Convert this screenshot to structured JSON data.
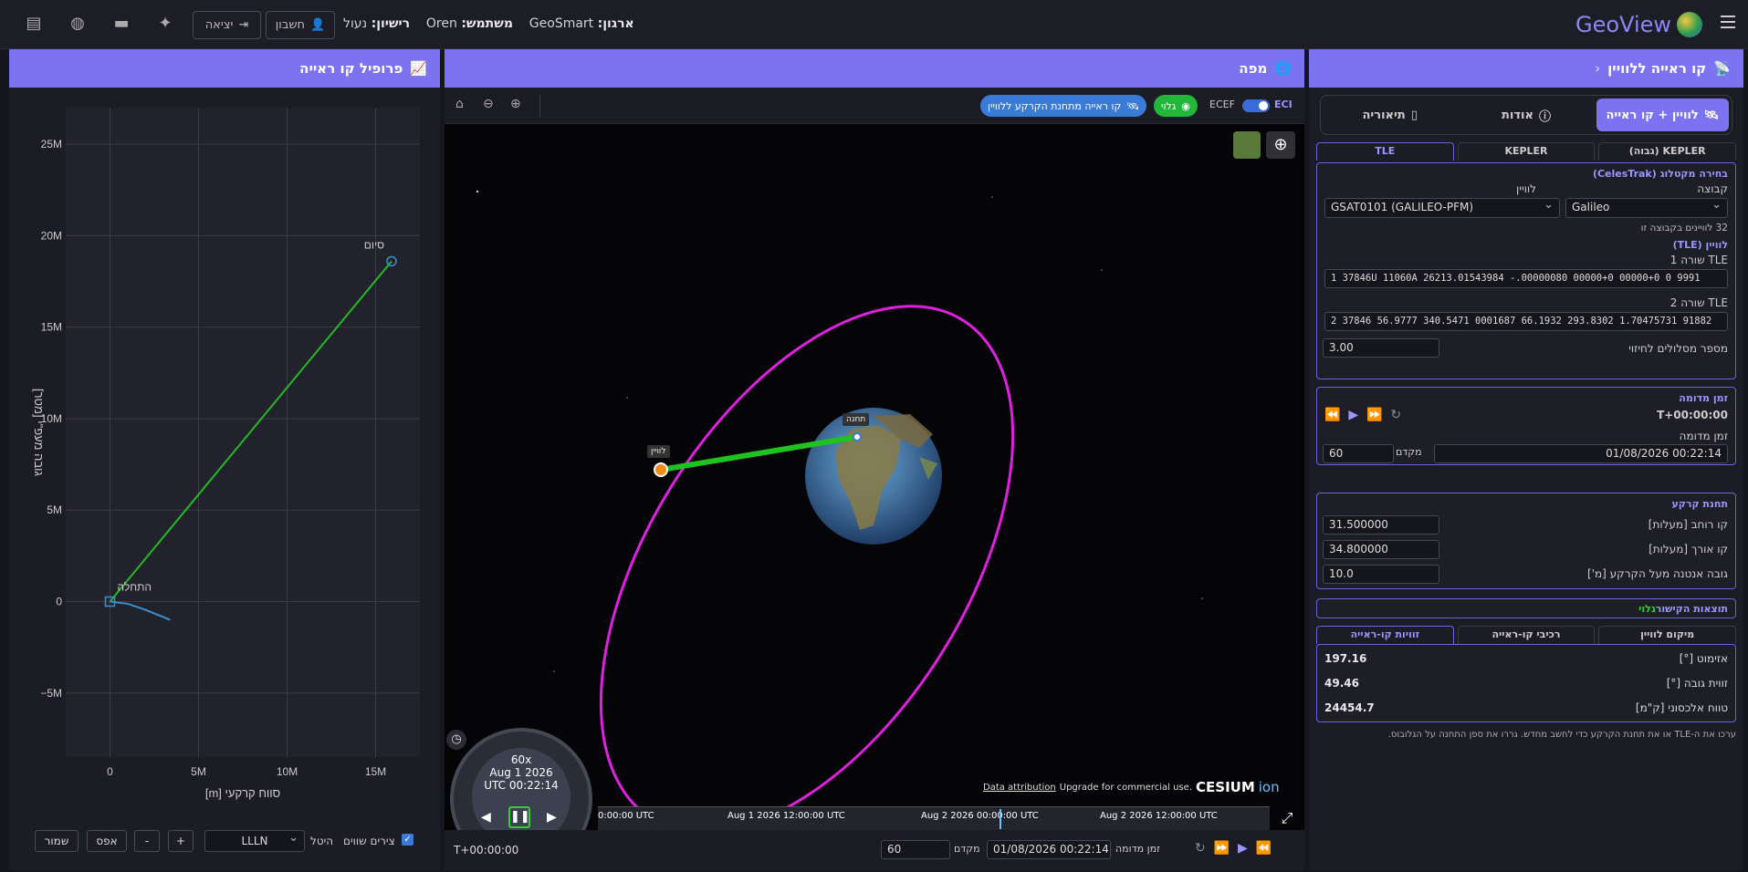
{
  "topbar": {
    "brand": "GeoView",
    "org_label": "ארגון:",
    "org_value": "GeoSmart",
    "user_label": "משתמש:",
    "user_value": "Oren",
    "license_label": "רישיון:",
    "license_value": "נעול",
    "account_btn": "חשבון",
    "logout_btn": "יציאה"
  },
  "right_panel": {
    "title": "קו ראייה ללוויין",
    "tabs": [
      "לוויין + קו ראייה",
      "אודות",
      "תיאוריה"
    ],
    "subtabs": [
      "KEPLER (גבוה)",
      "KEPLER",
      "TLE"
    ],
    "catalog": {
      "title": "בחירה מקטלוג (CelesTrak)",
      "group_label": "קבוצה",
      "group_value": "Galileo",
      "sat_label": "לוויין",
      "sat_value": "GSAT0101 (GALILEO-PFM)",
      "count_note": "32 לוויינים בקבוצה זו",
      "tle_title": "לוויין (TLE)",
      "tle1_label": "TLE שורה 1",
      "tle1_value": "1 37846U 11060A   26213.01543984 -.00000080  00000+0  00000+0 0  9991",
      "tle2_label": "TLE שורה 2",
      "tle2_value": "2 37846  56.9777 340.5471 0001687  66.1932 293.8302  1.70475731 91882",
      "revs_label": "מספר מסלולים לחיזוי",
      "revs_value": "3.00"
    },
    "sim_time": {
      "title": "זמן מדומה",
      "offset": "T+00:00:00",
      "time_label": "זמן מדומה",
      "time_value": "01/08/2026 00:22:14",
      "rate_label": "מקדם",
      "rate_value": "60"
    },
    "ground": {
      "title": "תחנת קרקע",
      "lat_label": "קו רוחב [מעלות]",
      "lat_value": "31.500000",
      "lon_label": "קו אורך [מעלות]",
      "lon_value": "34.800000",
      "alt_label": "גובה אנטנה מעל הקרקע [מ']",
      "alt_value": "10.0"
    },
    "results": {
      "title": "תוצאות הקישור",
      "status": "גלוי",
      "tabs": [
        "מיקום לוויין",
        "רכיבי קו-ראייה",
        "זוויות קו-ראייה"
      ],
      "azimuth_label": "אזימוט [°]",
      "azimuth_value": "197.16",
      "elev_label": "זווית גובה [°]",
      "elev_value": "49.46",
      "range_label": "טווח אלכסוני [ק\"מ]",
      "range_value": "24454.7"
    },
    "footnote": "ערכו את ה-TLE או את תחנת הקרקע כדי לחשב מחדש. גררו את ספן התחנה על הגלובוס."
  },
  "map_panel": {
    "title": "מפה",
    "eci_label": "ECI",
    "ecef_label": "ECEF",
    "visible_pill": "גלוי",
    "los_pill": "קו ראייה מתחנת הקרקע ללוויין",
    "sat_label": "לוויין",
    "station_label": "תחנה",
    "clock_rate": "60x",
    "clock_date": "Aug 1 2026",
    "clock_time": "UTC 00:22:14",
    "timeline_labels": [
      "0:00:00 UTC",
      "Aug 1 2026 12:00:00 UTC",
      "Aug 2 2026 00:00:00 UTC",
      "Aug 2 2026 12:00:00 UTC"
    ],
    "cesium_attr": "Data attribution",
    "cesium_upgrade": "Upgrade for commercial use.",
    "cesium_logo": "CESIUM",
    "cesium_ion": "ion",
    "bottom_offset": "T+00:00:00",
    "bottom_time_label": "זמן מדומה",
    "bottom_time_value": "01/08/2026 00:22:14",
    "bottom_rate_label": "מקדם",
    "bottom_rate_value": "60"
  },
  "left_panel": {
    "title": "פרופיל קו ראייה",
    "start_label": "התחלה",
    "end_label": "סיום",
    "save_btn": "שמור",
    "reset_btn": "אפס",
    "minus_btn": "-",
    "plus_btn": "+",
    "proj_value": "LLLN",
    "proj_label": "היטל",
    "equal_axes_label": "צירים שווים"
  },
  "chart_data": {
    "type": "line",
    "xlabel": "סווח קרקעי [m]",
    "ylabel": "גובה מעפ\"י [מטר]",
    "xlim": [
      -2500000,
      17500000
    ],
    "ylim": [
      -8500000,
      27000000
    ],
    "x_ticks": [
      0,
      5000000,
      10000000,
      15000000
    ],
    "x_tick_labels": [
      "0",
      "5M",
      "10M",
      "15M"
    ],
    "y_ticks": [
      -5000000,
      0,
      5000000,
      10000000,
      15000000,
      20000000,
      25000000
    ],
    "y_tick_labels": [
      "−5M",
      "0",
      "5M",
      "10M",
      "15M",
      "20M",
      "25M"
    ],
    "grid": true,
    "series": [
      {
        "color": "#22bb22",
        "x": [
          0,
          15900000
        ],
        "y": [
          0,
          18600000
        ]
      },
      {
        "color": "#3a90d0",
        "x": [
          0,
          1000000,
          2000000,
          3400000
        ],
        "y": [
          0,
          -120000,
          -450000,
          -1000000
        ]
      }
    ]
  },
  "colors": {
    "accent": "#7b73f0",
    "orbit": "#e020e0",
    "los": "#1fc21f",
    "satellite": "#f08a1a"
  }
}
